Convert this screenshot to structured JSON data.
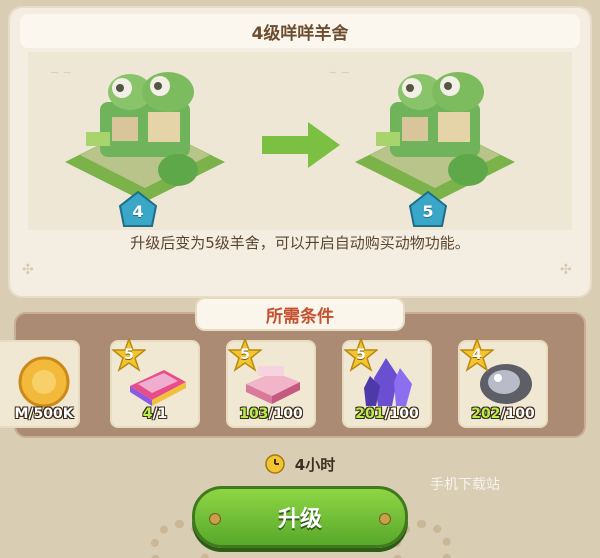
{
  "dialog": {
    "title": "4级咩咩羊舍",
    "description": "升级后变为5级羊舍，可以开启自动购买动物功能。",
    "current_level": "4",
    "next_level": "5"
  },
  "requirements": {
    "title": "所需条件",
    "items": [
      {
        "name": "coin",
        "stars": "",
        "count": "M/500K"
      },
      {
        "name": "rainbow-bar",
        "stars": "5",
        "have": "4",
        "need": "/1"
      },
      {
        "name": "pink-brick",
        "stars": "5",
        "have": "103",
        "need": "/100"
      },
      {
        "name": "purple-crystal",
        "stars": "5",
        "have": "201",
        "need": "/100"
      },
      {
        "name": "silver-ore",
        "stars": "4",
        "have": "202",
        "need": "/100"
      }
    ]
  },
  "time": {
    "label": "4小时",
    "icon": "clock-icon"
  },
  "upgrade_button": {
    "label": "升级"
  },
  "watermark": "手机下载站",
  "colors": {
    "accent_green": "#58a82a",
    "title_red": "#c4502f",
    "level_blue": "#3aa6c8"
  }
}
